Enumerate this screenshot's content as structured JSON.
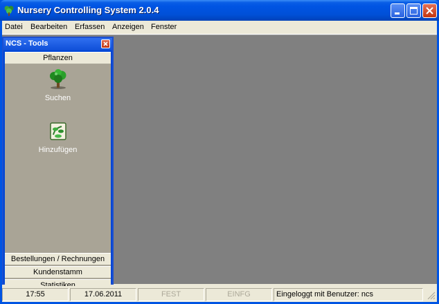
{
  "window": {
    "title": "Nursery Controlling System 2.0.4"
  },
  "menu": [
    "Datei",
    "Bearbeiten",
    "Erfassen",
    "Anzeigen",
    "Fenster"
  ],
  "tools_panel": {
    "title": "NCS - Tools",
    "groups": [
      "Pflanzen",
      "Bestellungen / Rechnungen",
      "Kundenstamm",
      "Statistiken"
    ],
    "items": [
      {
        "label": "Suchen",
        "icon": "tree-icon"
      },
      {
        "label": "Hinzufügen",
        "icon": "add-plant-icon"
      }
    ]
  },
  "statusbar": {
    "time": "17:55",
    "date": "17.06.2011",
    "fest": "FEST",
    "einfg": "EINFG",
    "user": "Eingeloggt mit Benutzer: ncs"
  },
  "colors": {
    "titlebar": "#0054e3",
    "mdi_background": "#808080",
    "tools_body": "#a9a496"
  }
}
